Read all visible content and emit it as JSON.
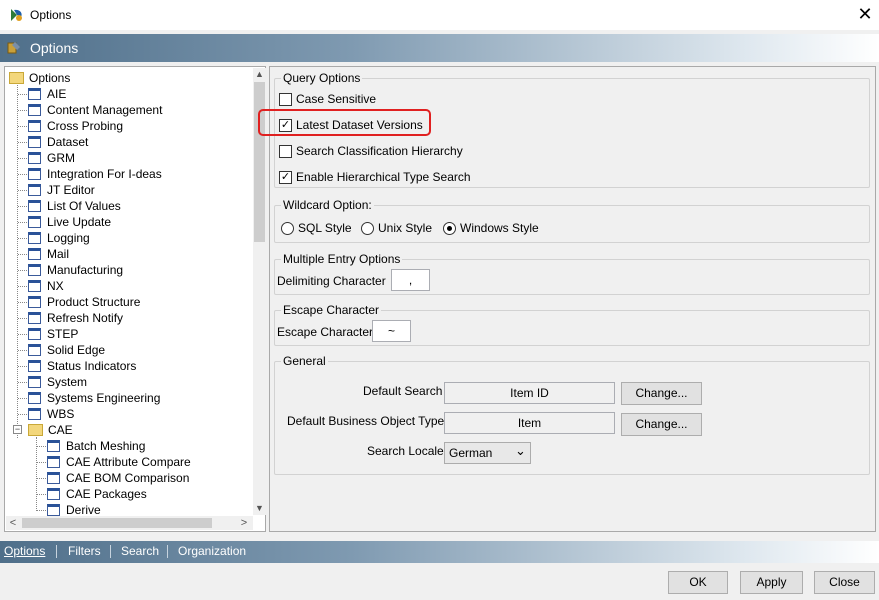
{
  "window": {
    "title": "Options",
    "close_glyph": "✕"
  },
  "header": {
    "title": "Options"
  },
  "tree": {
    "root": "Options",
    "items": [
      "AIE",
      "Content Management",
      "Cross Probing",
      "Dataset",
      "GRM",
      "Integration For I-deas",
      "JT Editor",
      "List Of Values",
      "Live Update",
      "Logging",
      "Mail",
      "Manufacturing",
      "NX",
      "Product Structure",
      "Refresh Notify",
      "STEP",
      "Solid Edge",
      "Status Indicators",
      "System",
      "Systems Engineering",
      "WBS"
    ],
    "cae_folder": "CAE",
    "cae_children": [
      "Batch Meshing",
      "CAE Attribute Compare",
      "CAE BOM Comparison",
      "CAE Packages",
      "Derive"
    ],
    "scroll_up": "▲",
    "scroll_down": "▼",
    "scroll_left": "<",
    "scroll_right": ">"
  },
  "query_options": {
    "legend": "Query Options",
    "case_sensitive": {
      "label": "Case Sensitive",
      "checked": false
    },
    "latest_dataset_versions": {
      "label": "Latest Dataset Versions",
      "checked": true
    },
    "search_classification": {
      "label": "Search Classification Hierarchy",
      "checked": false
    },
    "enable_hierarchical": {
      "label": "Enable Hierarchical Type Search",
      "checked": true
    },
    "check_glyph": "✓"
  },
  "wildcard": {
    "legend": "Wildcard Option:",
    "options": [
      "SQL Style",
      "Unix Style",
      "Windows Style"
    ],
    "selected": "Windows Style"
  },
  "multiple_entry": {
    "legend": "Multiple Entry Options",
    "label": "Delimiting Character",
    "value": ","
  },
  "escape": {
    "legend": "Escape Character",
    "label": "Escape Character",
    "value": "~"
  },
  "general": {
    "legend": "General",
    "default_search_label": "Default Search",
    "default_search_value": "Item ID",
    "default_bo_label": "Default Business Object Type",
    "default_bo_value": "Item",
    "change_label": "Change...",
    "search_locale_label": "Search Locale",
    "search_locale_value": "German",
    "dropdown_glyph": "⌄"
  },
  "tabs": [
    "Options",
    "Filters",
    "Search",
    "Organization"
  ],
  "active_tab": "Options",
  "footer": {
    "ok": "OK",
    "apply": "Apply",
    "close": "Close"
  }
}
